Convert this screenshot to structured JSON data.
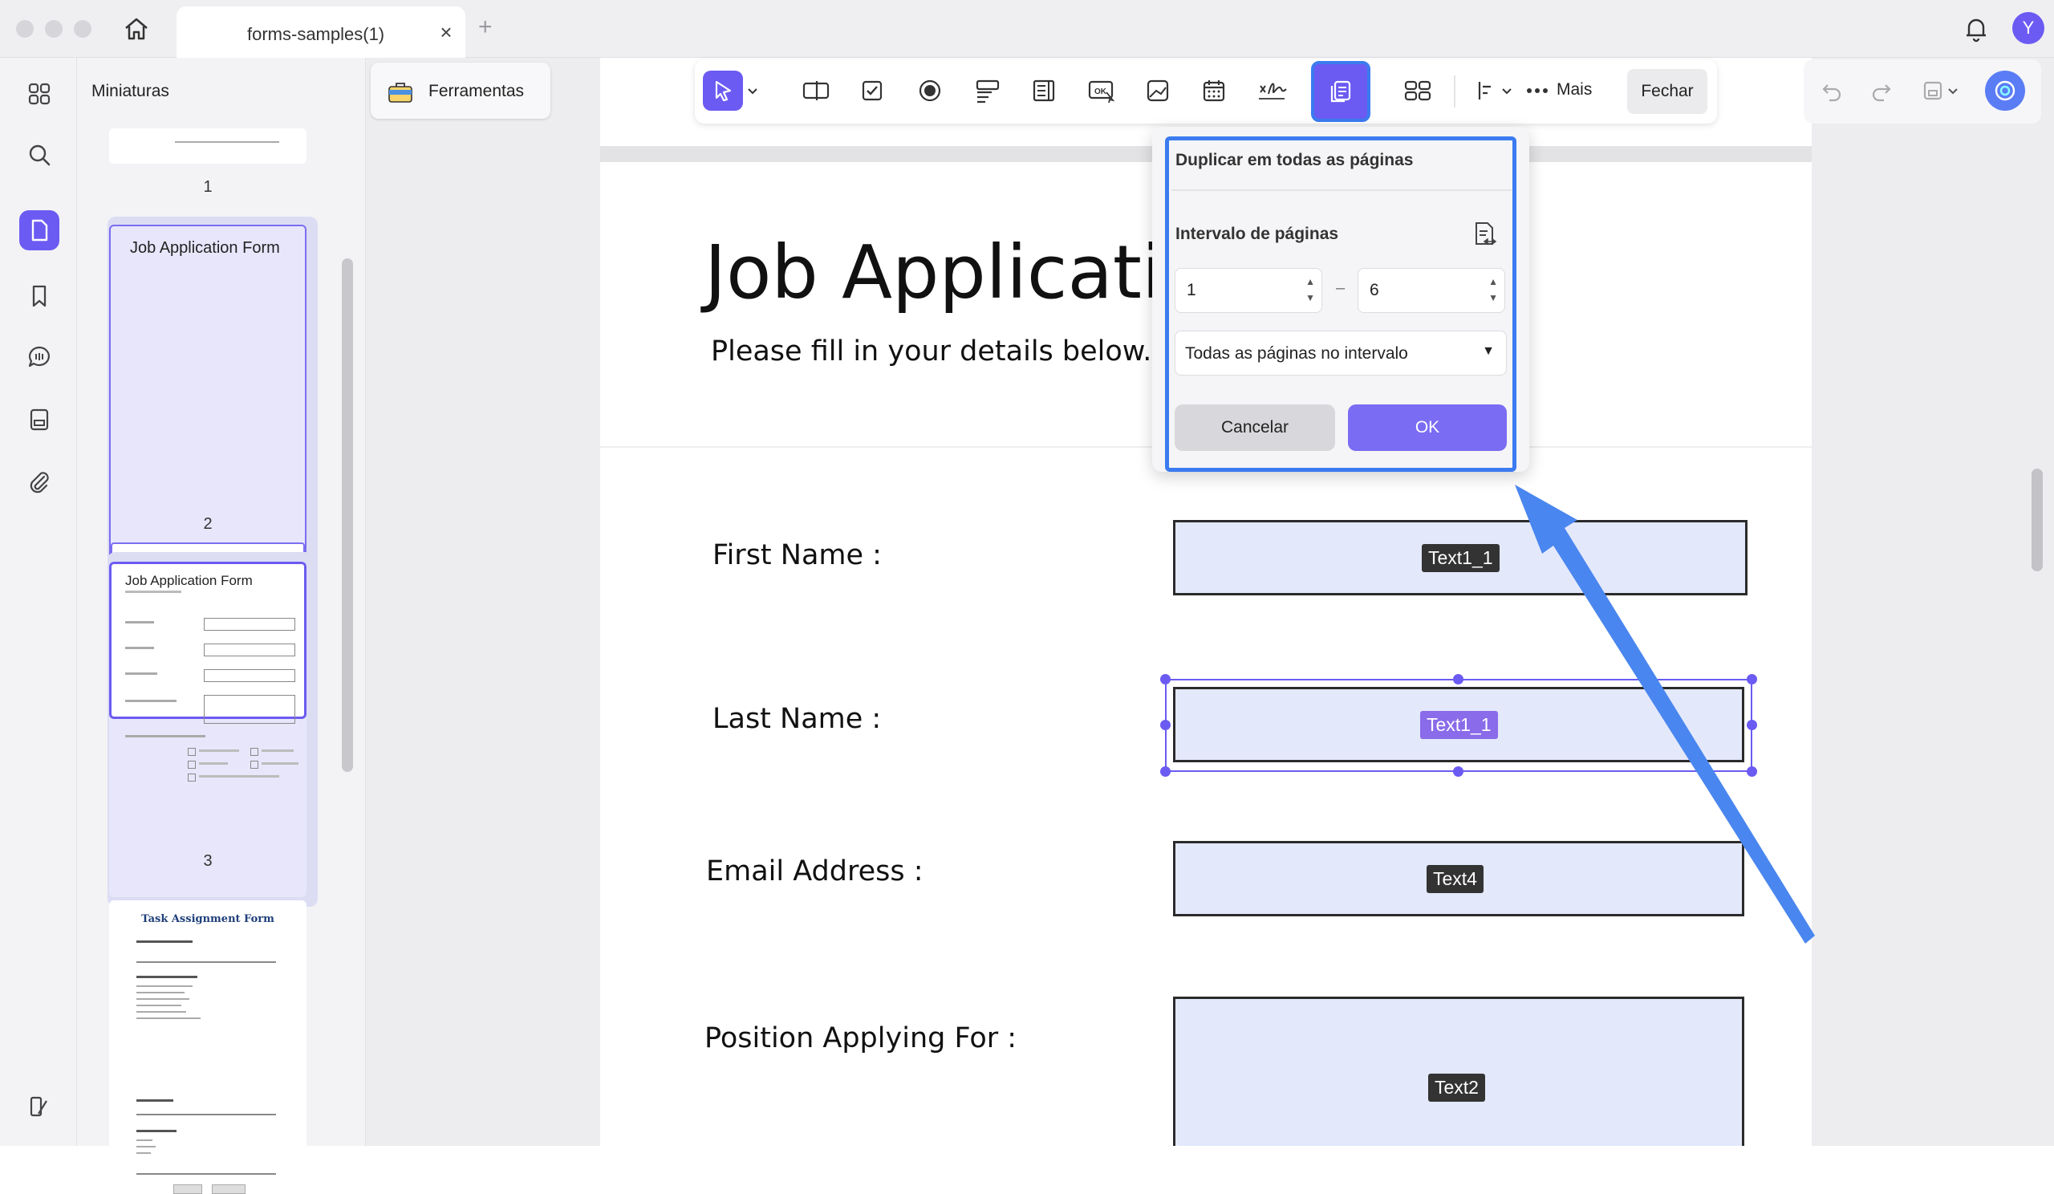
{
  "window": {
    "tab_title": "forms-samples(1)",
    "tab_close": "×",
    "tab_add": "+",
    "avatar_initial": "Y"
  },
  "left_rail": {
    "items": [
      "grid-icon",
      "search-icon",
      "pages-icon",
      "bookmark-icon",
      "comments-icon",
      "form-icon",
      "attachment-icon"
    ],
    "active": "pages-icon"
  },
  "thumbnails": {
    "title": "Miniaturas",
    "pages": [
      {
        "number": "1"
      },
      {
        "number": "2",
        "heading": "Job Application Form"
      },
      {
        "number": "3",
        "heading": "Job Application Form"
      },
      {
        "number": "",
        "heading": "Task Assignment Form"
      }
    ]
  },
  "tools_button": {
    "label": "Ferramentas"
  },
  "toolbar": {
    "more_label": "Mais",
    "close_label": "Fechar"
  },
  "document": {
    "title": "Job Applicatio",
    "subtitle": "Please fill in your details below.",
    "fields": [
      {
        "label": "First Name :",
        "tag": "Text1_1"
      },
      {
        "label": "Last Name :",
        "tag": "Text1_1"
      },
      {
        "label": "Email Address :",
        "tag": "Text4"
      },
      {
        "label": "Position Applying For :",
        "tag": "Text2"
      }
    ]
  },
  "popup": {
    "title": "Duplicar em todas as páginas",
    "range_label": "Intervalo de páginas",
    "from": "1",
    "to": "6",
    "range_separator": "–",
    "selection": "Todas as páginas no intervalo",
    "cancel": "Cancelar",
    "ok": "OK"
  },
  "colors": {
    "accent": "#6b5bf2",
    "highlight": "#3b7bf0",
    "field_fill": "#e3e8fb"
  }
}
